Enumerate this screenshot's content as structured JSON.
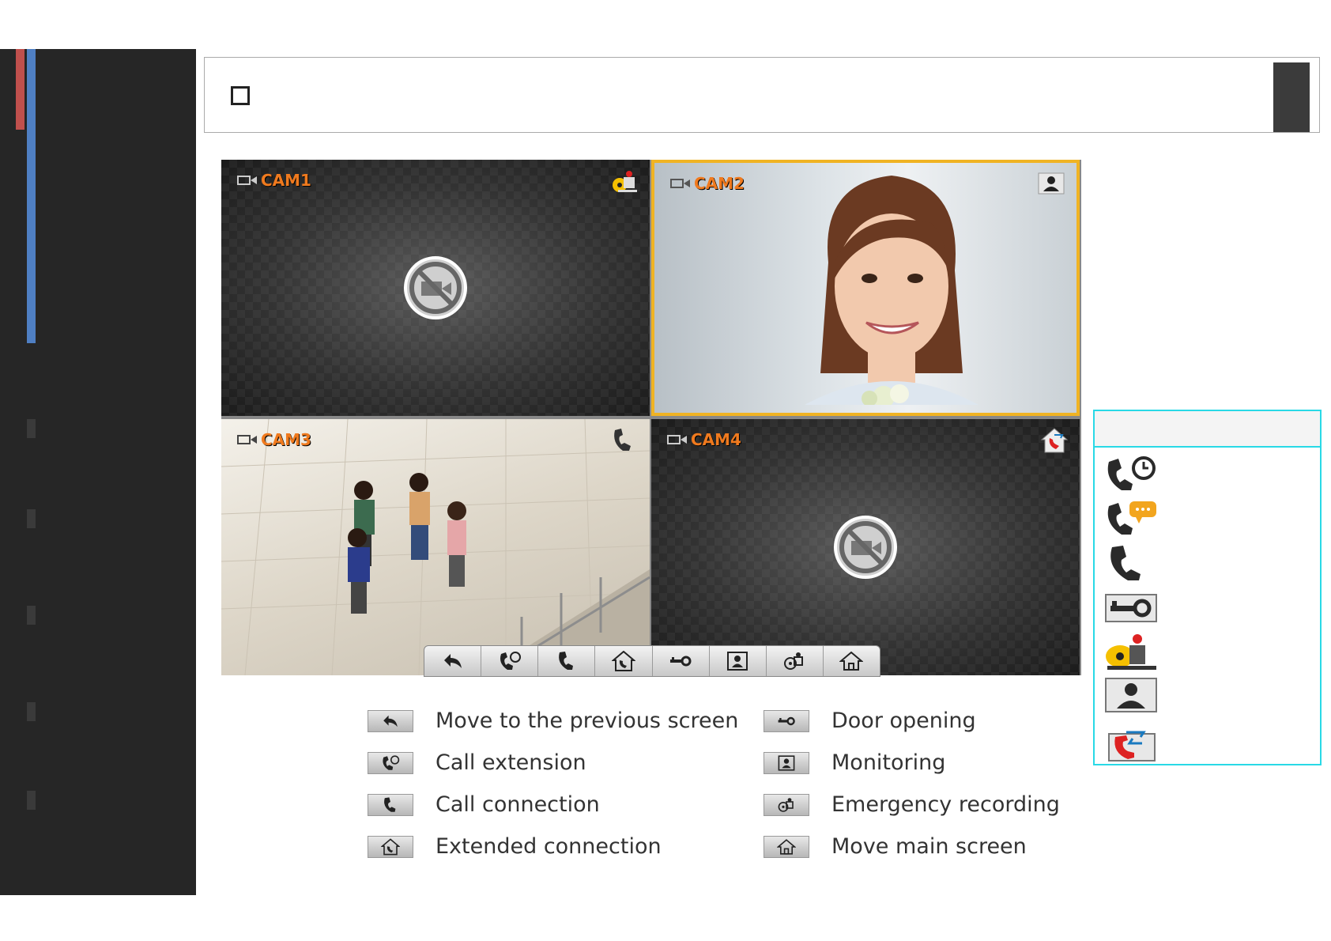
{
  "cameras": [
    {
      "label": "CAM1",
      "status_icon": "lock-record-icon",
      "feed": "no-signal"
    },
    {
      "label": "CAM2",
      "status_icon": "monitoring-icon",
      "feed": "visitor-face",
      "selected": true
    },
    {
      "label": "CAM3",
      "status_icon": "phone-icon",
      "feed": "lobby"
    },
    {
      "label": "CAM4",
      "status_icon": "extended-connection-icon",
      "feed": "no-signal"
    }
  ],
  "toolbar": [
    "back-icon",
    "call-extension-icon",
    "call-connection-icon",
    "extended-connection-icon",
    "door-key-icon",
    "monitoring-icon",
    "emergency-recording-icon",
    "home-icon"
  ],
  "legend": {
    "left": [
      {
        "icon": "back-icon",
        "text": "Move to the previous screen"
      },
      {
        "icon": "call-extension-icon",
        "text": "Call extension"
      },
      {
        "icon": "call-connection-icon",
        "text": "Call connection"
      },
      {
        "icon": "extended-connection-icon",
        "text": "Extended connection"
      }
    ],
    "right": [
      {
        "icon": "door-key-icon",
        "text": "Door opening"
      },
      {
        "icon": "monitoring-icon",
        "text": "Monitoring"
      },
      {
        "icon": "emergency-recording-icon",
        "text": "Emergency recording"
      },
      {
        "icon": "home-icon",
        "text": "Move main screen"
      }
    ]
  },
  "status_panel_icons": [
    "call-waiting-icon",
    "call-message-icon",
    "call-active-icon",
    "door-key-icon",
    "emergency-recording-icon",
    "monitoring-icon",
    "extended-connection-icon"
  ],
  "colors": {
    "accent_orange": "#f07a1e",
    "selected_border": "#f0b323",
    "panel_border": "#29d9e6",
    "sidebar_red": "#c0504d",
    "sidebar_blue": "#4f7fc3"
  }
}
